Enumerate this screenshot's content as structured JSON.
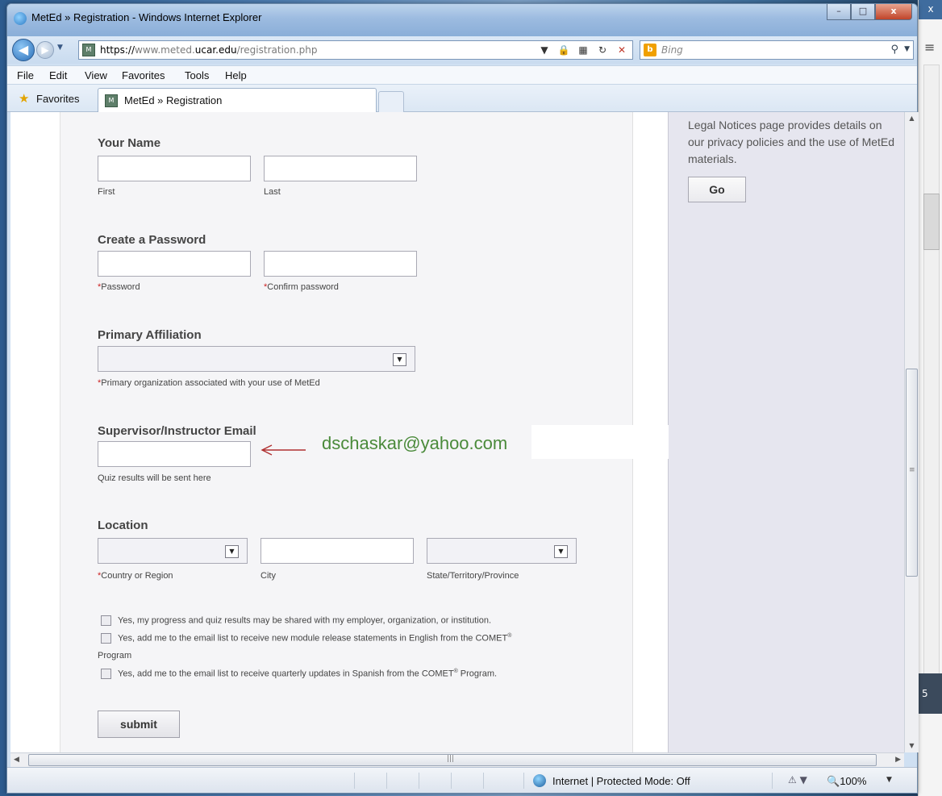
{
  "window": {
    "title": "MetEd » Registration - Windows Internet Explorer",
    "minimize_glyph": "–",
    "maximize_glyph": "□",
    "close_glyph": "x"
  },
  "address": {
    "url_scheme": "https://",
    "url_prefix": "www.meted.",
    "url_host": "ucar.edu",
    "url_path": "/registration.php"
  },
  "search": {
    "placeholder": "Bing"
  },
  "menu": [
    "File",
    "Edit",
    "View",
    "Favorites",
    "Tools",
    "Help"
  ],
  "favorites": {
    "label": "Favorites"
  },
  "tab": {
    "title": "MetEd » Registration"
  },
  "form": {
    "name": {
      "title": "Your Name",
      "first_label": "First",
      "last_label": "Last",
      "first_value": "",
      "last_value": ""
    },
    "password": {
      "title": "Create a Password",
      "password_label": "Password",
      "confirm_label": "Confirm password",
      "required_mark": "*"
    },
    "affiliation": {
      "title": "Primary Affiliation",
      "selected": "",
      "help": "Primary organization associated with your use of MetEd"
    },
    "supervisor": {
      "title": "Supervisor/Instructor Email",
      "value": "",
      "help": "Quiz results will be sent here"
    },
    "location": {
      "title": "Location",
      "country_label": "Country or Region",
      "city_label": "City",
      "state_label": "State/Territory/Province"
    },
    "checkboxes": [
      {
        "label": "Yes, my progress and quiz results may be shared with my employer, organization, or institution.",
        "checked": false
      },
      {
        "label": "Yes, add me to the email list to receive new module release statements in English from the COMET",
        "sup": "®",
        "label_tail": "Program",
        "checked": false
      },
      {
        "label": "Yes, add me to the email list to receive quarterly updates in Spanish from the COMET",
        "sup": "®",
        "label_tail": " Program.",
        "checked": false
      }
    ],
    "submit_label": "submit"
  },
  "annotation": {
    "text": "dschaskar@yahoo.com",
    "color": "#4a8a3a"
  },
  "sidebar": {
    "text": "Legal Notices page provides details on our privacy policies and the use of MetEd materials.",
    "go_label": "Go"
  },
  "status": {
    "zone": "Internet | Protected Mode: Off",
    "zoom": "100%"
  },
  "desktop": {
    "hamburger": "≡",
    "badge": "5",
    "close_glyph": "x"
  }
}
